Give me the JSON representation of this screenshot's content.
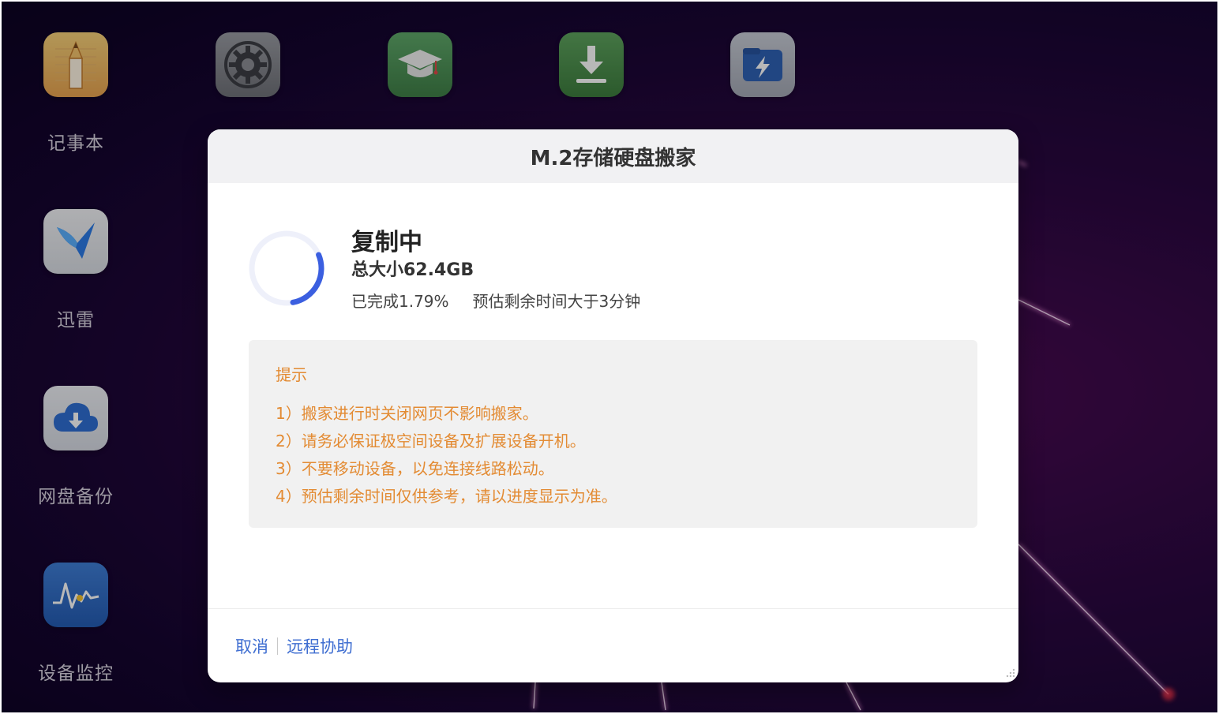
{
  "desktop": {
    "top_icons": [
      {
        "name": "settings-app-icon",
        "color": "#7d7f86"
      },
      {
        "name": "graduation-cap-app-icon",
        "color": "#4f8f55"
      },
      {
        "name": "download-app-icon",
        "color": "#4e8f4e"
      },
      {
        "name": "lightning-folder-app-icon",
        "color": "#2f62b4"
      }
    ],
    "apps": [
      {
        "label": "记事本",
        "icon": "notepad-icon"
      },
      {
        "label": "迅雷",
        "icon": "thunder-bird-icon"
      },
      {
        "label": "网盘备份",
        "icon": "cloud-backup-icon"
      },
      {
        "label": "设备监控",
        "icon": "monitor-chart-icon"
      }
    ]
  },
  "dialog": {
    "title": "M.2存储硬盘搬家",
    "status": "复制中",
    "total_size": "总大小62.4GB",
    "progress_percent": 1.79,
    "completed_text": "已完成1.79%",
    "remaining_text": "预估剩余时间大于3分钟",
    "tips": {
      "title": "提示",
      "items": [
        "1）搬家进行时关闭网页不影响搬家。",
        "2）请务必保证极空间设备及扩展设备开机。",
        "3）不要移动设备，以免连接线路松动。",
        "4）预估剩余时间仅供参考，请以进度显示为准。"
      ]
    },
    "footer": {
      "cancel_label": "取消",
      "remote_help_label": "远程协助"
    }
  },
  "colors": {
    "accent_blue": "#3f6ed1",
    "tip_orange": "#e38b33",
    "spinner_blue": "#3b5fe0"
  }
}
